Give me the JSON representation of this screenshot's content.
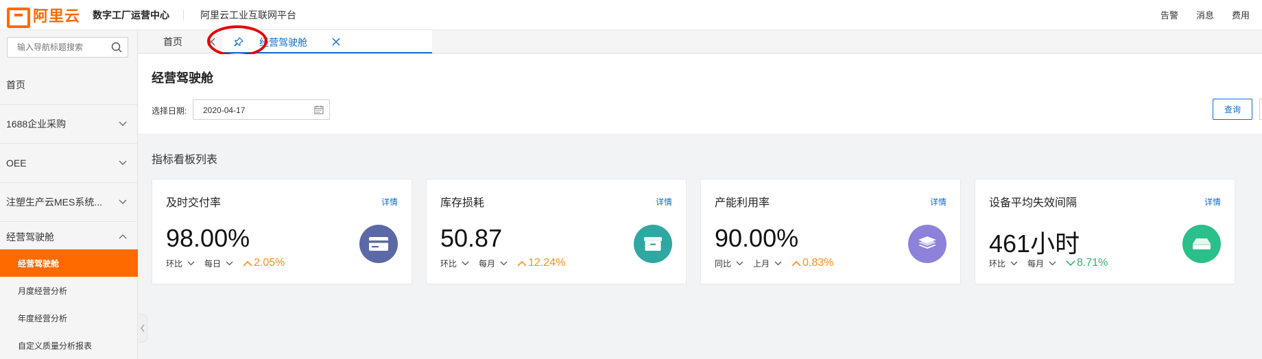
{
  "header": {
    "logo_text": "阿里云",
    "app_title": "数字工厂运营中心",
    "platform": "阿里云工业互联网平台",
    "right_items": [
      "告警",
      "消息",
      "费用"
    ]
  },
  "sidebar": {
    "search_placeholder": "输入导航标题搜索",
    "items": [
      {
        "label": "首页"
      },
      {
        "label": "1688企业采购"
      },
      {
        "label": "OEE"
      },
      {
        "label": "注塑生产云MES系统..."
      },
      {
        "label": "经营驾驶舱"
      }
    ],
    "sub_items": [
      {
        "label": "经营驾驶舱",
        "active": true
      },
      {
        "label": "月度经营分析",
        "active": false
      },
      {
        "label": "年度经营分析",
        "active": false
      },
      {
        "label": "自定义质量分析报表",
        "active": false
      }
    ]
  },
  "tabs": {
    "home": "首页",
    "active": "经营驾驶舱"
  },
  "main": {
    "title": "经营驾驶舱",
    "date_label": "选择日期:",
    "date_value": "2020-04-17",
    "query_button": "查询",
    "section_title": "指标看板列表",
    "detail_label": "详情"
  },
  "cards": [
    {
      "title": "及时交付率",
      "value": "98.00%",
      "compare": "环比",
      "period": "每日",
      "trend": "2.05%",
      "trend_dir": "up",
      "icon": "card-icon",
      "icon_color": "#5b6aa6"
    },
    {
      "title": "库存损耗",
      "value": "50.87",
      "compare": "环比",
      "period": "每月",
      "trend": "12.24%",
      "trend_dir": "up",
      "icon": "box-icon",
      "icon_color": "#2fa7a3"
    },
    {
      "title": "产能利用率",
      "value": "90.00%",
      "compare": "同比",
      "period": "上月",
      "trend": "0.83%",
      "trend_dir": "up",
      "icon": "layers-icon",
      "icon_color": "#8c82d9"
    },
    {
      "title": "设备平均失效间隔",
      "value": "461小时",
      "compare": "环比",
      "period": "每月",
      "trend": "8.71%",
      "trend_dir": "good",
      "icon": "device-icon",
      "icon_color": "#2bbf8a"
    }
  ]
}
